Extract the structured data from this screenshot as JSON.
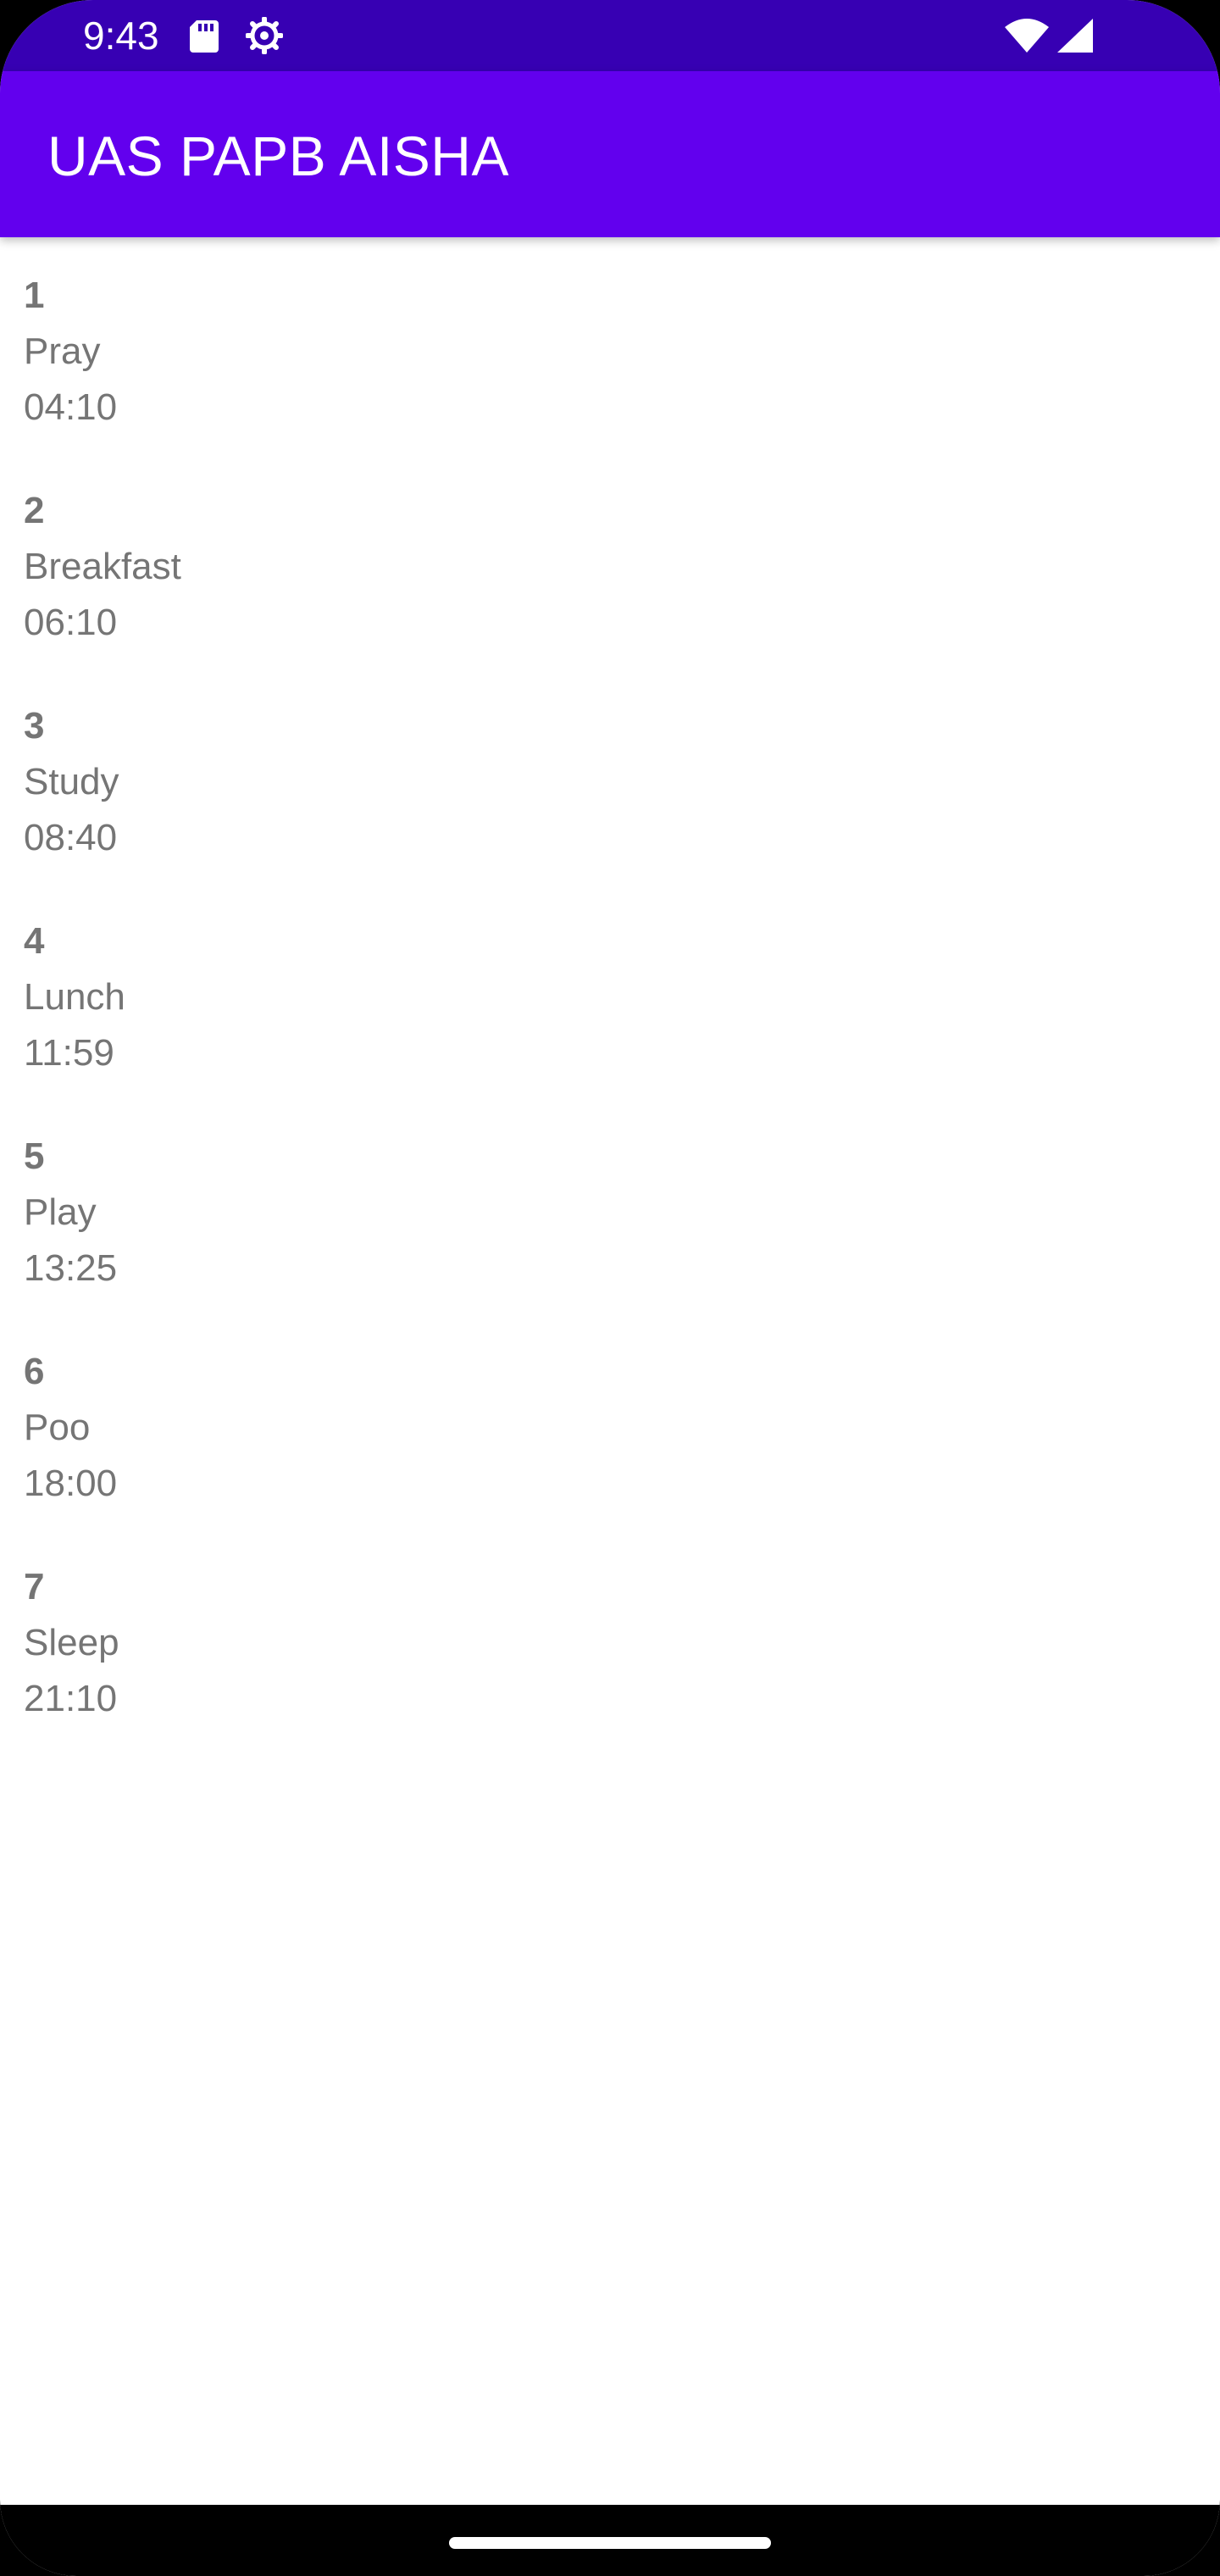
{
  "status_bar": {
    "time": "9:43",
    "icons": [
      "sd-card-icon",
      "gear-icon",
      "wifi-icon",
      "signal-icon"
    ]
  },
  "app_bar": {
    "title": "UAS PAPB AISHA",
    "color": "#6200ee"
  },
  "colors": {
    "status_bar": "#3700b3",
    "text": "#757575"
  },
  "items": [
    {
      "number": "1",
      "name": "Pray",
      "time": "04:10"
    },
    {
      "number": "2",
      "name": "Breakfast",
      "time": "06:10"
    },
    {
      "number": "3",
      "name": "Study",
      "time": "08:40"
    },
    {
      "number": "4",
      "name": "Lunch",
      "time": "11:59"
    },
    {
      "number": "5",
      "name": "Play",
      "time": "13:25"
    },
    {
      "number": "6",
      "name": "Poo",
      "time": "18:00"
    },
    {
      "number": "7",
      "name": "Sleep",
      "time": "21:10"
    }
  ]
}
